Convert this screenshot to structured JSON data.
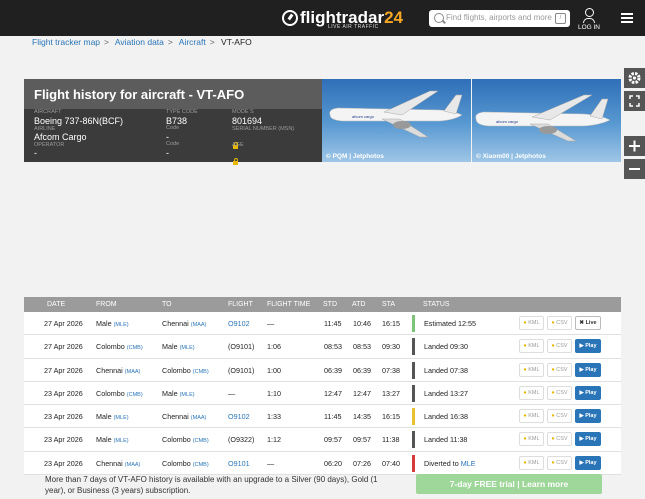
{
  "app": {
    "logo_text": "flightradar",
    "logo_number": "24",
    "tagline": "LIVE AIR TRAFFIC",
    "search_placeholder": "Find flights, airports and more",
    "search_shortcut": "/",
    "login_label": "LOG IN"
  },
  "breadcrumb": [
    "Flight tracker map",
    "Aviation data",
    "Aircraft",
    "VT-AFO"
  ],
  "aircraft": {
    "title": "Flight history for aircraft - VT-AFO",
    "aircraft_label": "AIRCRAFT",
    "aircraft_value": "Boeing 737-86N(BCF)",
    "airline_label": "AIRLINE",
    "airline_value": "Afcom Cargo",
    "operator_label": "OPERATOR",
    "operator_value": "-",
    "type_code_label": "TYPE CODE",
    "type_code_value": "B738",
    "code_label": "Code",
    "code_value": "-",
    "code2_label": "Code",
    "code2_value": "-",
    "mode_s_label": "MODE S",
    "mode_s_value": "801694",
    "serial_label": "SERIAL NUMBER (MSN)",
    "age_label": "AGE"
  },
  "photos": [
    {
      "credit": "© PQM | Jetphotos"
    },
    {
      "credit": "© Xiaom00 | Jetphotos"
    }
  ],
  "table": {
    "headers": [
      "DATE",
      "FROM",
      "TO",
      "FLIGHT",
      "FLIGHT TIME",
      "STD",
      "ATD",
      "STA",
      "STATUS"
    ],
    "rows": [
      {
        "date": "27 Apr 2026",
        "from": "Male",
        "from_code": "(MLE)",
        "to": "Chennai",
        "to_code": "(MAA)",
        "flight": "O9102",
        "flight_link": true,
        "time": "—",
        "std": "11:45",
        "atd": "10:46",
        "sta": "16:15",
        "status": "Estimated 12:55",
        "status_link": "",
        "status_color": "#7cc47a",
        "action": "Live"
      },
      {
        "date": "27 Apr 2026",
        "from": "Colombo",
        "from_code": "(CMB)",
        "to": "Male",
        "to_code": "(MLE)",
        "flight": "(O9101)",
        "flight_link": false,
        "time": "1:06",
        "std": "08:53",
        "atd": "08:53",
        "sta": "09:30",
        "status": "Landed 09:30",
        "status_link": "",
        "status_color": "#555555",
        "action": "Play"
      },
      {
        "date": "27 Apr 2026",
        "from": "Chennai",
        "from_code": "(MAA)",
        "to": "Colombo",
        "to_code": "(CMB)",
        "flight": "(O9101)",
        "flight_link": false,
        "time": "1:00",
        "std": "06:39",
        "atd": "06:39",
        "sta": "07:38",
        "status": "Landed 07:38",
        "status_link": "",
        "status_color": "#555555",
        "action": "Play"
      },
      {
        "date": "23 Apr 2026",
        "from": "Colombo",
        "from_code": "(CMB)",
        "to": "Male",
        "to_code": "(MLE)",
        "flight": "—",
        "flight_link": false,
        "time": "1:10",
        "std": "12:47",
        "atd": "12:47",
        "sta": "13:27",
        "status": "Landed 13:27",
        "status_link": "",
        "status_color": "#555555",
        "action": "Play"
      },
      {
        "date": "23 Apr 2026",
        "from": "Male",
        "from_code": "(MLE)",
        "to": "Chennai",
        "to_code": "(MAA)",
        "flight": "O9102",
        "flight_link": true,
        "time": "1:33",
        "std": "11:45",
        "atd": "14:35",
        "sta": "16:15",
        "status": "Landed 16:38",
        "status_link": "",
        "status_color": "#e8c22e",
        "action": "Play"
      },
      {
        "date": "23 Apr 2026",
        "from": "Male",
        "from_code": "(MLE)",
        "to": "Colombo",
        "to_code": "(CMB)",
        "flight": "(O9322)",
        "flight_link": false,
        "time": "1:12",
        "std": "09:57",
        "atd": "09:57",
        "sta": "11:38",
        "status": "Landed 11:38",
        "status_link": "",
        "status_color": "#555555",
        "action": "Play"
      },
      {
        "date": "23 Apr 2026",
        "from": "Chennai",
        "from_code": "(MAA)",
        "to": "Colombo",
        "to_code": "(CMB)",
        "flight": "O9101",
        "flight_link": true,
        "time": "—",
        "std": "06:20",
        "atd": "07:26",
        "sta": "07:40",
        "status": "Diverted to ",
        "status_link": "MLE",
        "status_color": "#d63b3b",
        "action": "Play"
      }
    ],
    "kml_label": "KML",
    "csv_label": "CSV"
  },
  "footer": {
    "text": "More than 7 days of VT-AFO history is available with an upgrade to a Silver (90 days), Gold (1 year), or Business (3 years) subscription.",
    "trial_button": "7-day FREE trial | Learn more"
  }
}
